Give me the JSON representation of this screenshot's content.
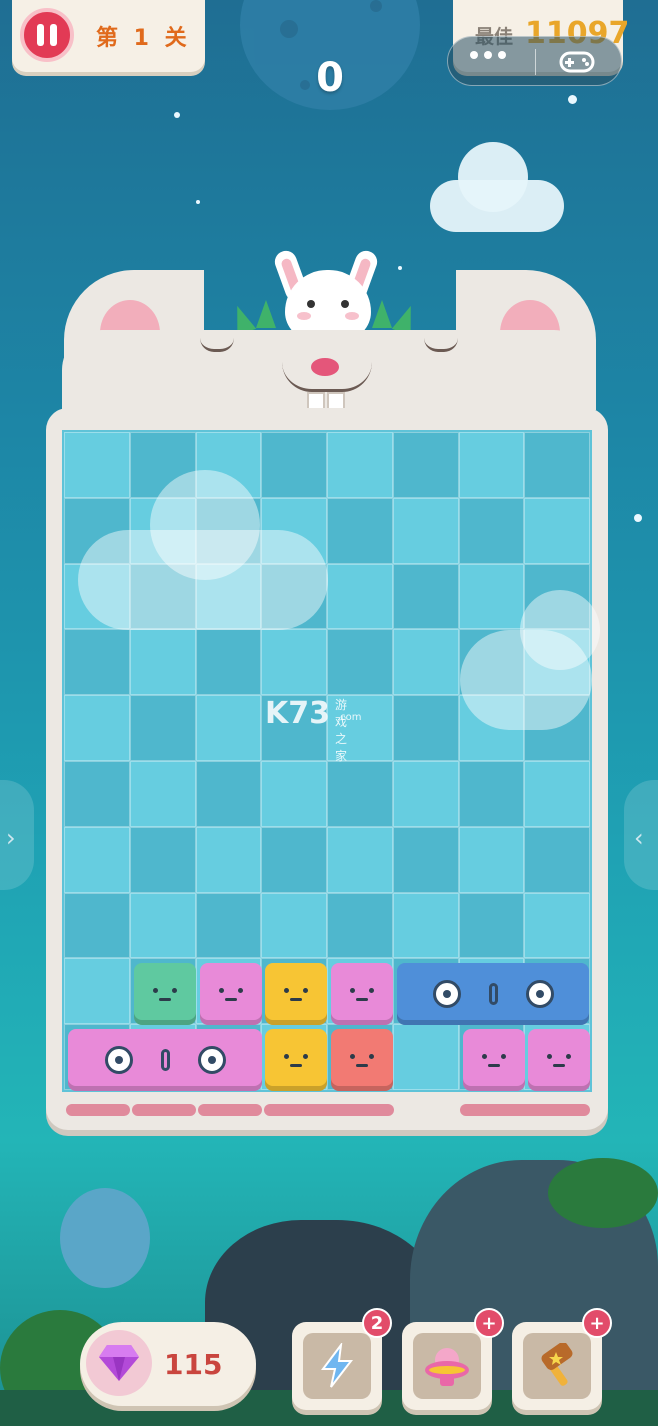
{
  "top_bar": {
    "level_label": "第 1 关",
    "best_label": "最佳",
    "best_value": "11097",
    "score": "0"
  },
  "icons": {
    "pause": "pause-icon",
    "more": "more-dots-icon",
    "gamepad": "gamepad-icon",
    "gem": "gem-icon",
    "lightning": "lightning-icon",
    "ufo": "ufo-icon",
    "hammer": "hammer-icon"
  },
  "board": {
    "rows": 10,
    "cols": 8
  },
  "watermark": {
    "brand": "K73",
    "cn": "游戏之家",
    "domain": ".com"
  },
  "bottom_bar": {
    "gem_count": "115",
    "tools": [
      {
        "name": "lightning",
        "badge": "2"
      },
      {
        "name": "ufo",
        "badge": "+"
      },
      {
        "name": "hammer",
        "badge": "+"
      }
    ]
  },
  "colors": {
    "green": "#5fc9a0",
    "pink": "#e88ad8",
    "yellow": "#f7c534",
    "salmon": "#f27a73",
    "blue": "#4f8fd9"
  }
}
